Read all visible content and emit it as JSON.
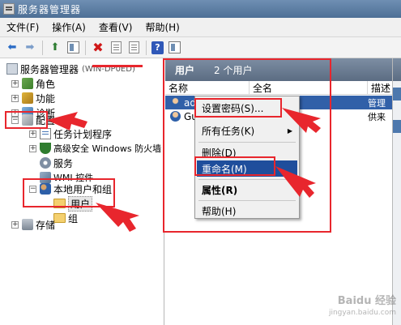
{
  "window": {
    "title": "服务器管理器"
  },
  "menubar": {
    "items": [
      "文件(F)",
      "操作(A)",
      "查看(V)",
      "帮助(H)"
    ]
  },
  "toolbar": {
    "buttons": [
      "back-icon",
      "forward-icon",
      "up-folder-icon",
      "show-tree-icon",
      "delete-icon",
      "properties-icon",
      "export-icon",
      "help-icon",
      "console-icon"
    ]
  },
  "tree": {
    "root": "服务器管理器",
    "root_suffix": "(WIN-DP0ED)",
    "roles": "角色",
    "features": "功能",
    "diagnostics": "诊断",
    "configuration": "配置",
    "task_scheduler": "任务计划程序",
    "firewall": "高级安全 Windows 防火墙",
    "services": "服务",
    "wmi": "WMI 控件",
    "local_users_groups": "本地用户和组",
    "users": "用户",
    "groups": "组",
    "storage": "存储"
  },
  "content": {
    "header_title": "用户",
    "header_count": "2 个用户",
    "columns": [
      "名称",
      "全名",
      "描述"
    ],
    "rows": [
      {
        "name": "adm",
        "fullname": "",
        "desc": "管理"
      },
      {
        "name": "Gu",
        "fullname": "",
        "desc": "供来"
      }
    ]
  },
  "context_menu": {
    "set_password": "设置密码(S)...",
    "all_tasks": "所有任务(K)",
    "delete": "删除(D)",
    "rename": "重命名(M)",
    "properties": "属性(R)",
    "help": "帮助(H)"
  },
  "watermark": {
    "brand": "Baidu 经验",
    "url": "jingyan.baidu.com"
  },
  "colors": {
    "annotation_red": "#e8262d",
    "selection_blue": "#1f4e9c",
    "header_slate": "#6b7c91"
  }
}
